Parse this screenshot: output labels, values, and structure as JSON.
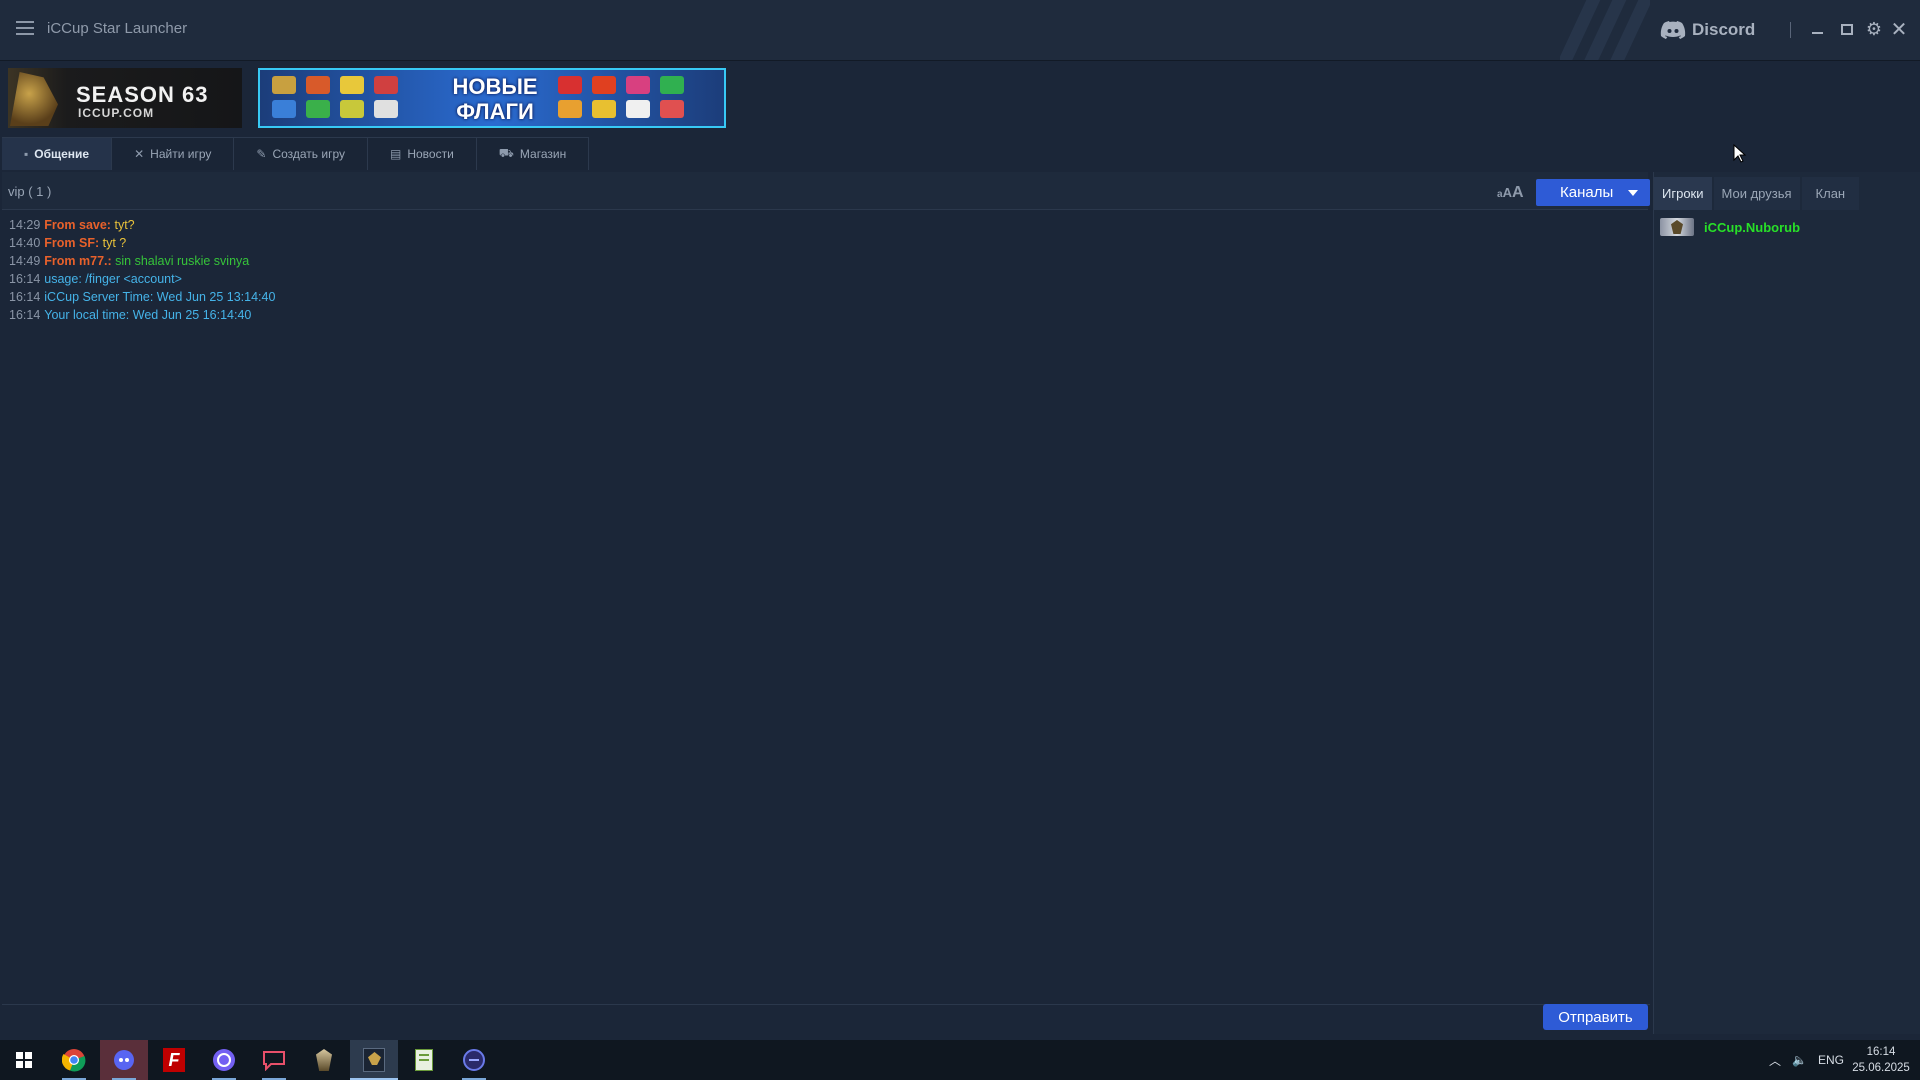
{
  "window": {
    "title": "iCCup Star Launcher",
    "discord_label": "Discord"
  },
  "banners": {
    "season": {
      "line1": "SEASON 63",
      "line2": "ICCUP.COM"
    },
    "flags": {
      "line1": "НОВЫЕ",
      "line2": "ФЛАГИ"
    }
  },
  "tabs": [
    {
      "label": "Общение",
      "icon": "chat-icon",
      "active": true
    },
    {
      "label": "Найти игру",
      "icon": "swords-icon"
    },
    {
      "label": "Создать игру",
      "icon": "wrench-icon"
    },
    {
      "label": "Новости",
      "icon": "news-icon"
    },
    {
      "label": "Магазин",
      "icon": "cart-icon"
    }
  ],
  "chat": {
    "channel": "vip ( 1 )",
    "font_size_label": {
      "small": "a",
      "mid": "A",
      "large": "A"
    },
    "channels_button": "Каналы",
    "messages": [
      {
        "time": "14:29",
        "from": "From save:",
        "text": "tyt?",
        "color": "#e9c23a"
      },
      {
        "time": "14:40",
        "from": "From SF:",
        "text": "tyt ?",
        "color": "#e9c23a"
      },
      {
        "time": "14:49",
        "from": "From m77.:",
        "text": "sin shalavi ruskie svinya",
        "color": "#36c43a"
      },
      {
        "time": "16:14",
        "text": "usage: /finger <account>"
      },
      {
        "time": "16:14",
        "text": "iCCup Server Time: Wed Jun 25 13:14:40"
      },
      {
        "time": "16:14",
        "text": "Your local time: Wed Jun 25 16:14:40"
      }
    ],
    "input_value": "",
    "send_button": "Отправить"
  },
  "players_panel": {
    "tabs": [
      "Игроки",
      "Мои друзья",
      "Клан"
    ],
    "active_tab": 0,
    "players": [
      {
        "name": "iCCup.Nuborub"
      }
    ]
  },
  "taskbar": {
    "apps": [
      "windows-start",
      "chrome",
      "discord",
      "filezilla",
      "viber",
      "chat-app",
      "starcraft",
      "starcraft-beta",
      "notepad",
      "launcher"
    ],
    "tray_lang": "ENG",
    "time": "16:14",
    "date": "25.06.2025"
  },
  "colors": {
    "accent": "#2e5bd6",
    "background": "#1b2638",
    "player_online": "#28e028",
    "from_name": "#e8612b",
    "system_msg": "#45b3e8"
  }
}
